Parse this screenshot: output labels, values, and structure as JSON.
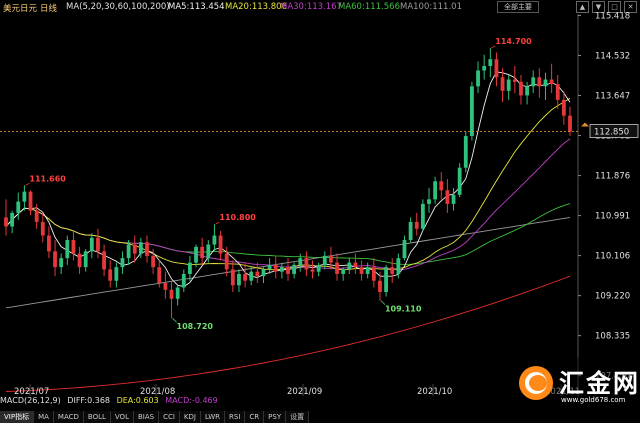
{
  "header": {
    "symbol": "美元日元",
    "period": "日线",
    "ma_label": "MA(5,20,30,60,100,200)",
    "ma5": "MA5:113.454",
    "ma20": "MA20:113.806",
    "ma30": "MA30:113.167",
    "ma60": "MA60:111.566",
    "ma100": "MA100:111.01",
    "main_button": "全部主要"
  },
  "macd_line": {
    "label": "MACD(26,12,9)",
    "diff": "DIFF:0.368",
    "dea": "DEA:0.603",
    "macd": "MACD:-0.469"
  },
  "tabs": [
    "VIP指标",
    "MA",
    "MACD",
    "BOLL",
    "VOL",
    "BIAS",
    "CCI",
    "KDJ",
    "LWR",
    "RSI",
    "CR",
    "PSY",
    "设置"
  ],
  "logo": {
    "text": "汇金网",
    "url": "www.gold678.com"
  },
  "colors": {
    "up": "#2ec27e",
    "down": "#e5383b",
    "ma5": "#f0f0f0",
    "ma20": "#e6e63a",
    "ma30": "#c13fc9",
    "ma60": "#3ec23e",
    "ma100": "#9a9a9a",
    "ma200": "#e32d2d"
  },
  "chart_data": {
    "type": "candlestick",
    "y_ticks": [
      115.418,
      114.532,
      113.647,
      112.761,
      111.876,
      110.991,
      110.106,
      109.22,
      108.335,
      107.45
    ],
    "ylim": [
      107.0,
      115.45
    ],
    "current_price": "112.850",
    "current_value": 112.85,
    "x_labels": [
      "2021/07",
      "2021/08",
      "2021/09",
      "2021/10",
      "2021/11"
    ],
    "annotations": [
      {
        "text": "111.660",
        "value": 111.66,
        "color": "#ff4040"
      },
      {
        "text": "110.800",
        "value": 110.8,
        "color": "#ff4040"
      },
      {
        "text": "108.720",
        "value": 108.72,
        "color": "#6fe06f"
      },
      {
        "text": "109.110",
        "value": 109.11,
        "color": "#6fe06f"
      },
      {
        "text": "114.700",
        "value": 114.7,
        "color": "#ff4040"
      }
    ],
    "candles": [
      [
        110.95,
        111.35,
        110.75,
        110.55
      ],
      [
        110.75,
        111.1,
        111.05,
        110.6
      ],
      [
        111.05,
        111.5,
        111.3,
        110.9
      ],
      [
        111.3,
        111.66,
        111.52,
        111.1
      ],
      [
        111.52,
        111.55,
        111.1,
        111.0
      ],
      [
        111.1,
        111.25,
        110.85,
        110.7
      ],
      [
        110.85,
        111.05,
        110.55,
        110.4
      ],
      [
        110.55,
        110.75,
        110.2,
        110.05
      ],
      [
        110.2,
        110.45,
        109.85,
        109.65
      ],
      [
        109.85,
        110.15,
        110.05,
        109.7
      ],
      [
        110.05,
        110.55,
        110.45,
        109.9
      ],
      [
        110.45,
        110.65,
        110.15,
        110.0
      ],
      [
        110.15,
        110.3,
        109.85,
        109.7
      ],
      [
        109.85,
        110.25,
        110.2,
        109.75
      ],
      [
        110.2,
        110.6,
        110.5,
        110.05
      ],
      [
        110.5,
        110.7,
        110.2,
        110.05
      ],
      [
        110.2,
        110.35,
        109.8,
        109.65
      ],
      [
        109.8,
        110.0,
        109.55,
        109.4
      ],
      [
        109.55,
        109.95,
        109.85,
        109.4
      ],
      [
        109.85,
        110.2,
        110.05,
        109.7
      ],
      [
        110.05,
        110.45,
        110.35,
        109.9
      ],
      [
        110.35,
        110.55,
        110.15,
        109.95
      ],
      [
        110.15,
        110.5,
        110.4,
        110.05
      ],
      [
        110.4,
        110.55,
        110.1,
        109.95
      ],
      [
        110.1,
        110.25,
        109.85,
        109.7
      ],
      [
        109.85,
        110.0,
        109.5,
        109.4
      ],
      [
        109.5,
        109.75,
        109.35,
        109.15
      ],
      [
        109.35,
        109.55,
        109.15,
        108.72
      ],
      [
        109.15,
        109.45,
        109.4,
        109.0
      ],
      [
        109.4,
        109.8,
        109.7,
        109.3
      ],
      [
        109.7,
        110.1,
        109.95,
        109.55
      ],
      [
        109.95,
        110.35,
        110.3,
        109.85
      ],
      [
        110.3,
        110.5,
        110.05,
        109.9
      ],
      [
        110.05,
        110.45,
        110.35,
        109.95
      ],
      [
        110.35,
        110.8,
        110.55,
        110.2
      ],
      [
        110.55,
        110.65,
        110.15,
        110.0
      ],
      [
        110.15,
        110.3,
        109.8,
        109.65
      ],
      [
        109.8,
        110.0,
        109.45,
        109.3
      ],
      [
        109.45,
        109.8,
        109.7,
        109.3
      ],
      [
        109.7,
        109.95,
        109.55,
        109.4
      ],
      [
        109.55,
        109.85,
        109.75,
        109.45
      ],
      [
        109.75,
        109.95,
        109.65,
        109.5
      ],
      [
        109.65,
        109.85,
        109.8,
        109.5
      ],
      [
        109.8,
        110.05,
        109.9,
        109.7
      ],
      [
        109.9,
        110.1,
        109.75,
        109.6
      ],
      [
        109.75,
        109.95,
        109.85,
        109.6
      ],
      [
        109.85,
        110.05,
        109.7,
        109.55
      ],
      [
        109.7,
        109.95,
        109.9,
        109.6
      ],
      [
        109.9,
        110.15,
        110.05,
        109.75
      ],
      [
        110.05,
        110.2,
        109.8,
        109.65
      ],
      [
        109.8,
        110.0,
        109.75,
        109.6
      ],
      [
        109.75,
        109.95,
        109.9,
        109.65
      ],
      [
        109.9,
        110.2,
        110.1,
        109.8
      ],
      [
        110.1,
        110.3,
        109.95,
        109.8
      ],
      [
        109.95,
        110.15,
        109.7,
        109.55
      ],
      [
        109.7,
        109.85,
        109.8,
        109.55
      ],
      [
        109.8,
        110.05,
        109.95,
        109.7
      ],
      [
        109.95,
        110.15,
        109.85,
        109.7
      ],
      [
        109.85,
        110.0,
        109.7,
        109.55
      ],
      [
        109.7,
        109.95,
        109.85,
        109.6
      ],
      [
        109.85,
        110.05,
        109.55,
        109.4
      ],
      [
        109.55,
        109.75,
        109.3,
        109.11
      ],
      [
        109.3,
        109.9,
        109.85,
        109.2
      ],
      [
        109.85,
        110.05,
        109.7,
        109.5
      ],
      [
        109.7,
        110.15,
        110.05,
        109.6
      ],
      [
        110.05,
        110.55,
        110.45,
        110.0
      ],
      [
        110.45,
        110.95,
        110.85,
        110.4
      ],
      [
        110.85,
        111.05,
        110.7,
        110.55
      ],
      [
        110.7,
        111.35,
        111.25,
        110.65
      ],
      [
        111.25,
        111.6,
        111.35,
        111.05
      ],
      [
        111.35,
        111.85,
        111.75,
        111.25
      ],
      [
        111.75,
        111.95,
        111.55,
        111.35
      ],
      [
        111.55,
        111.8,
        111.25,
        111.05
      ],
      [
        111.25,
        111.6,
        111.45,
        111.1
      ],
      [
        111.45,
        112.15,
        112.05,
        111.4
      ],
      [
        112.05,
        112.85,
        112.75,
        111.95
      ],
      [
        112.75,
        113.95,
        113.85,
        112.65
      ],
      [
        113.85,
        114.4,
        114.2,
        113.7
      ],
      [
        114.2,
        114.55,
        114.3,
        114.0
      ],
      [
        114.3,
        114.7,
        114.45,
        114.05
      ],
      [
        114.45,
        114.6,
        114.05,
        113.85
      ],
      [
        114.05,
        114.25,
        113.75,
        113.5
      ],
      [
        113.75,
        114.1,
        114.0,
        113.55
      ],
      [
        114.0,
        114.3,
        113.95,
        113.7
      ],
      [
        113.95,
        114.1,
        113.65,
        113.45
      ],
      [
        113.65,
        113.95,
        113.85,
        113.45
      ],
      [
        113.85,
        114.2,
        114.05,
        113.7
      ],
      [
        114.05,
        114.25,
        113.85,
        113.6
      ],
      [
        113.85,
        114.15,
        114.0,
        113.55
      ],
      [
        114.0,
        114.35,
        113.9,
        113.7
      ],
      [
        113.9,
        114.1,
        113.55,
        113.35
      ],
      [
        113.55,
        113.75,
        113.2,
        113.0
      ],
      [
        113.2,
        113.4,
        112.85,
        112.75
      ]
    ]
  }
}
